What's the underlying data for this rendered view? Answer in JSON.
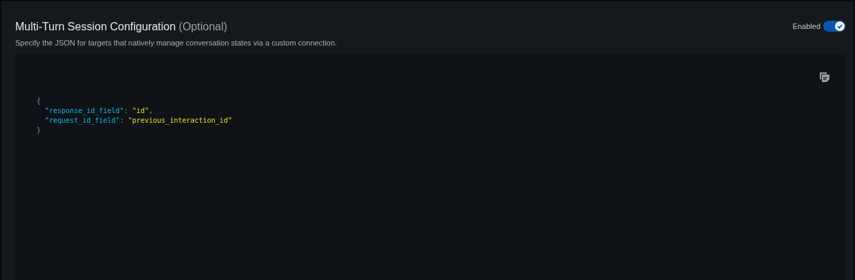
{
  "section": {
    "title": "Multi-Turn Session Configuration",
    "title_suffix": "(Optional)",
    "description": "Specify the JSON for targets that natively manage conversation states via a custom connection.",
    "toggle": {
      "label": "Enabled",
      "on": true
    }
  },
  "editor": {
    "lines": [
      [
        {
          "kind": "punct",
          "text": "{"
        }
      ],
      [
        {
          "kind": "key",
          "text": "\"response_id_field\""
        },
        {
          "kind": "punct",
          "text": ": "
        },
        {
          "kind": "string",
          "text": "\"id\""
        },
        {
          "kind": "punct",
          "text": ","
        }
      ],
      [
        {
          "kind": "key",
          "text": "\"request_id_field\""
        },
        {
          "kind": "punct",
          "text": ": "
        },
        {
          "kind": "string",
          "text": "\"previous_interaction_id\""
        }
      ],
      [
        {
          "kind": "punct",
          "text": "}"
        }
      ]
    ]
  }
}
